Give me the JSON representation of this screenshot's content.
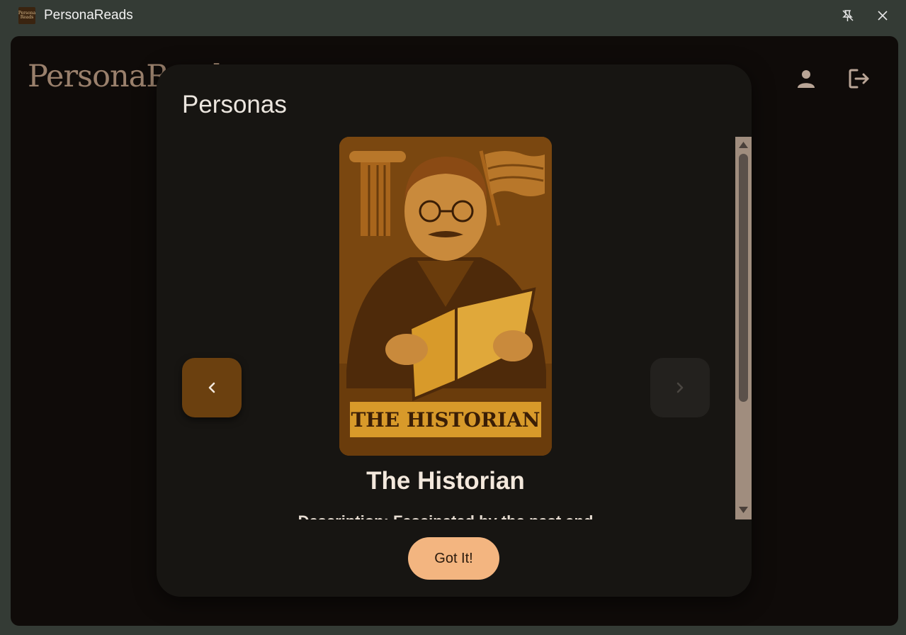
{
  "window": {
    "title": "PersonaReads",
    "icon_text_line1": "Persona",
    "icon_text_line2": "Reads"
  },
  "header": {
    "brand": "PersonaReads",
    "profile_icon": "person-icon",
    "logout_icon": "logout-icon"
  },
  "dialog": {
    "title": "Personas",
    "persona": {
      "card_banner": "THE HISTORIAN",
      "name": "The Historian",
      "description": "Description: Fascinated by the past and"
    },
    "confirm_label": "Got It!"
  },
  "colors": {
    "accent": "#f3b580",
    "nav_active": "#6b400f",
    "card_bg": "#7a4710",
    "banner": "#d89a2a"
  }
}
